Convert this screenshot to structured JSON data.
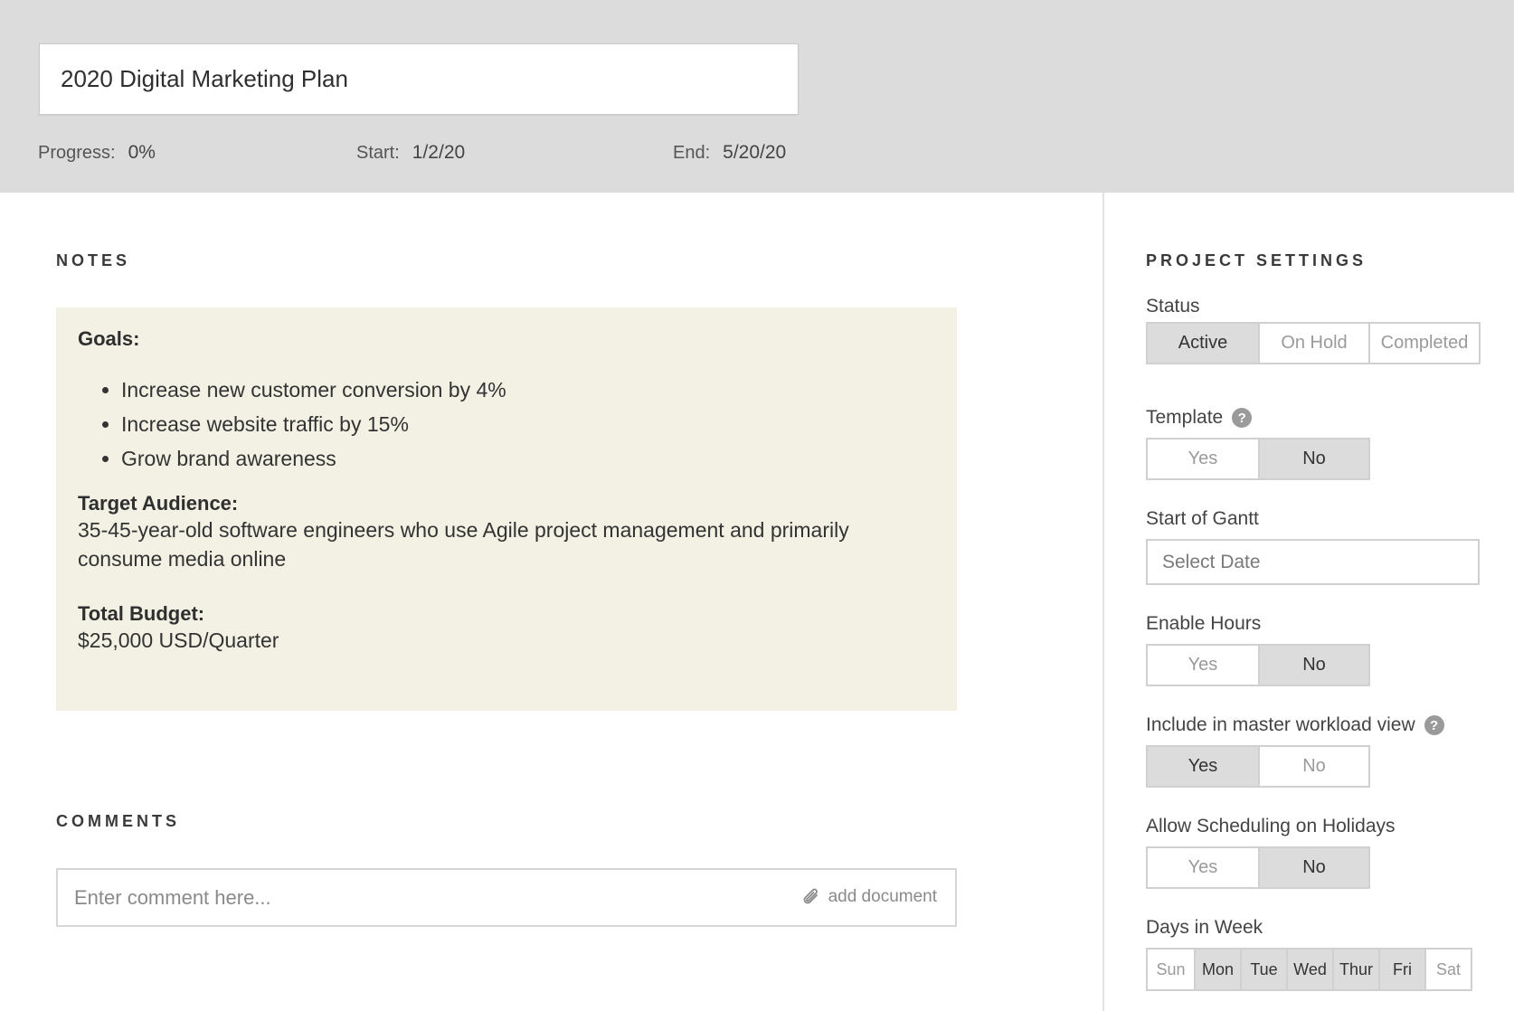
{
  "project": {
    "title": "2020 Digital Marketing Plan",
    "progress_label": "Progress:",
    "progress_value": "0%",
    "start_label": "Start:",
    "start_value": "1/2/20",
    "end_label": "End:",
    "end_value": "5/20/20"
  },
  "notes": {
    "section_label": "NOTES",
    "goals_heading": "Goals:",
    "goals": [
      "Increase new customer conversion by 4%",
      "Increase website traffic by 15%",
      "Grow brand awareness"
    ],
    "audience_heading": "Target Audience:",
    "audience_text": "35-45-year-old software engineers who use Agile project management and primarily consume media online",
    "budget_heading": "Total Budget:",
    "budget_text": "$25,000 USD/Quarter",
    "background_color": "#f2f1e4"
  },
  "comments": {
    "section_label": "COMMENTS",
    "placeholder": "Enter comment here...",
    "add_document_label": "add document"
  },
  "settings": {
    "section_label": "PROJECT SETTINGS",
    "status": {
      "label": "Status",
      "options": [
        "Active",
        "On Hold",
        "Completed"
      ],
      "selected": "Active"
    },
    "template": {
      "label": "Template",
      "help_icon": "?",
      "options": [
        "Yes",
        "No"
      ],
      "selected": "No"
    },
    "start_of_gantt": {
      "label": "Start of Gantt",
      "placeholder": "Select Date"
    },
    "enable_hours": {
      "label": "Enable Hours",
      "options": [
        "Yes",
        "No"
      ],
      "selected": "No"
    },
    "master_workload": {
      "label": "Include in master workload view",
      "help_icon": "?",
      "options": [
        "Yes",
        "No"
      ],
      "selected": "Yes"
    },
    "holidays": {
      "label": "Allow Scheduling on Holidays",
      "options": [
        "Yes",
        "No"
      ],
      "selected": "No"
    },
    "days_in_week": {
      "label": "Days in Week",
      "days": [
        "Sun",
        "Mon",
        "Tue",
        "Wed",
        "Thur",
        "Fri",
        "Sat"
      ],
      "selected": [
        "Mon",
        "Tue",
        "Wed",
        "Thur",
        "Fri"
      ]
    }
  },
  "colors": {
    "header_bg": "#dcdcdc",
    "selected_option_bg": "#dcdcdc",
    "border": "#d0d0d0"
  }
}
